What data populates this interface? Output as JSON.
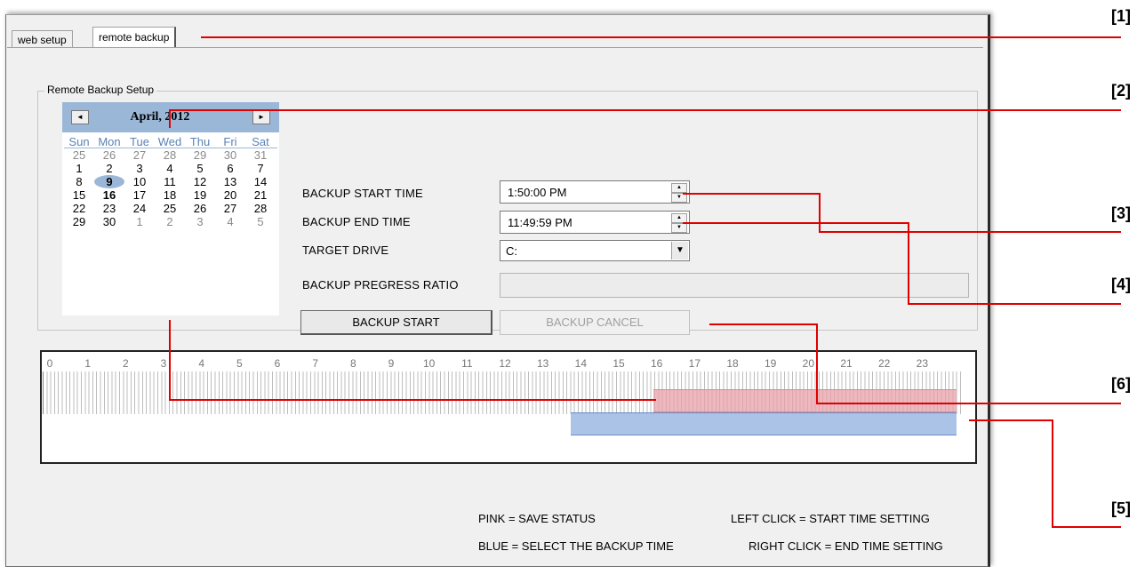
{
  "tabs": [
    {
      "label": "web setup"
    },
    {
      "label": "remote backup"
    }
  ],
  "group": {
    "title": "Remote Backup Setup"
  },
  "calendar": {
    "month_title": "April, 2012",
    "prev_label": "◄",
    "next_label": "►",
    "weekdays": [
      "Sun",
      "Mon",
      "Tue",
      "Wed",
      "Thu",
      "Fri",
      "Sat"
    ],
    "weeks": [
      [
        "25",
        "26",
        "27",
        "28",
        "29",
        "30",
        "31"
      ],
      [
        "1",
        "2",
        "3",
        "4",
        "5",
        "6",
        "7"
      ],
      [
        "8",
        "9",
        "10",
        "11",
        "12",
        "13",
        "14"
      ],
      [
        "15",
        "16",
        "17",
        "18",
        "19",
        "20",
        "21"
      ],
      [
        "22",
        "23",
        "24",
        "25",
        "26",
        "27",
        "28"
      ],
      [
        "29",
        "30",
        "1",
        "2",
        "3",
        "4",
        "5"
      ]
    ],
    "selected_day": "9",
    "today": "16"
  },
  "form": {
    "start_label": "BACKUP START TIME",
    "start_value": "1:50:00 PM",
    "end_label": "BACKUP END TIME",
    "end_value": "11:49:59 PM",
    "drive_label": "TARGET DRIVE",
    "drive_value": "C:",
    "progress_label": "BACKUP PREGRESS RATIO",
    "progress_fraction": 0,
    "start_button": "BACKUP START",
    "cancel_button": "BACKUP CANCEL"
  },
  "timeline": {
    "hours": [
      "0",
      "1",
      "2",
      "3",
      "4",
      "5",
      "6",
      "7",
      "8",
      "9",
      "10",
      "11",
      "12",
      "13",
      "14",
      "15",
      "16",
      "17",
      "18",
      "19",
      "20",
      "21",
      "22",
      "23"
    ],
    "save_status_range_hours": [
      16,
      24
    ],
    "backup_select_range_hours": [
      13.83,
      24
    ]
  },
  "legend": {
    "pink": "PINK = SAVE STATUS",
    "blue": "BLUE = SELECT THE BACKUP TIME",
    "left_click": "LEFT CLICK = START TIME SETTING",
    "right_click": "RIGHT CLICK = END TIME SETTING"
  },
  "callouts": [
    "[1]",
    "[2]",
    "[3]",
    "[4]",
    "[5]",
    "[6]"
  ],
  "colors": {
    "annotation": "#e00000",
    "pink": "#e8a0aa",
    "blue": "#96b4e1",
    "calendar_header": "#9bb7d8"
  }
}
